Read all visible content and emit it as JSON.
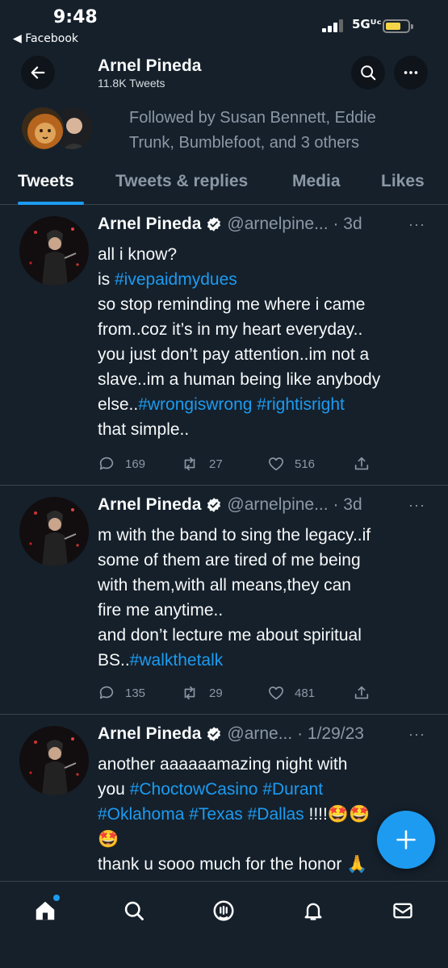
{
  "status_bar": {
    "time": "9:48",
    "back_app": "◀ Facebook",
    "network": "5Gᵁᶜ"
  },
  "header": {
    "title": "Arnel Pineda",
    "subtitle": "11.8K Tweets",
    "back_icon": "arrow-left-icon",
    "search_icon": "search-icon",
    "more_icon": "more-horizontal-icon"
  },
  "followed_by": {
    "line1": "Followed by Susan Bennett, Eddie",
    "line2": "Trunk, Bumblefoot, and 3 others"
  },
  "tabs": [
    {
      "label": "Tweets",
      "active": true
    },
    {
      "label": "Tweets & replies",
      "active": false
    },
    {
      "label": "Media",
      "active": false
    },
    {
      "label": "Likes",
      "active": false
    }
  ],
  "tweets": [
    {
      "name": "Arnel Pineda",
      "handle": "@arnelpine...",
      "date": "3d",
      "lines": [
        [
          "all i know?"
        ],
        [
          "is ",
          "#ivepaidmydues"
        ],
        [
          "so stop reminding me where i came"
        ],
        [
          "from..coz it’s in my heart everyday.."
        ],
        [
          "you just don’t pay attention..im not a"
        ],
        [
          "slave..im a human being like anybody"
        ],
        [
          "else..",
          "#wrongiswrong",
          " ",
          "#rightisright"
        ],
        [
          "that simple.."
        ]
      ],
      "replies": "169",
      "retweets": "27",
      "likes": "516"
    },
    {
      "name": "Arnel Pineda",
      "handle": "@arnelpine...",
      "date": "3d",
      "lines": [
        [
          "m with the band to sing the legacy..if"
        ],
        [
          "some of them are tired of me being"
        ],
        [
          "with them,with all means,they can"
        ],
        [
          "fire me anytime.."
        ],
        [
          "and don’t lecture me about spiritual"
        ],
        [
          "BS..",
          "#walkthetalk"
        ]
      ],
      "replies": "135",
      "retweets": "29",
      "likes": "481"
    },
    {
      "name": "Arnel Pineda",
      "handle": "@arne...",
      "date": "1/29/23",
      "lines": [
        [
          "another aaaaaamazing night with"
        ],
        [
          "you ",
          "#ChoctowCasino",
          " ",
          "#Durant"
        ],
        [
          "#Oklahoma",
          " ",
          "#Texas",
          " ",
          "#Dallas",
          " !!!!🤩🤩"
        ],
        [
          "🤩"
        ],
        [
          "thank u sooo much for the honor 🙏"
        ]
      ]
    }
  ],
  "fab": {
    "icon": "plus-icon"
  },
  "bottom_nav": [
    "home-icon",
    "search-icon",
    "spaces-icon",
    "notifications-icon",
    "messages-icon"
  ]
}
